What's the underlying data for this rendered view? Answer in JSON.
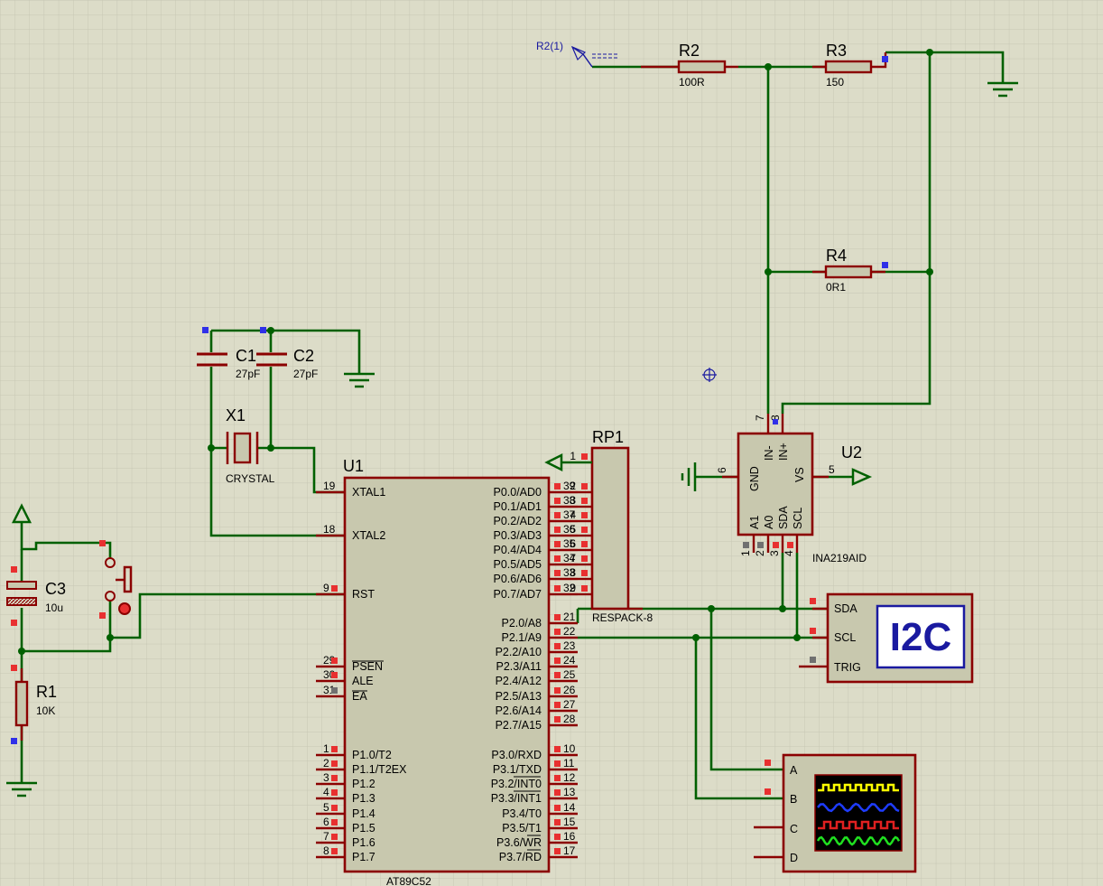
{
  "terminal": {
    "label": "R2(1)"
  },
  "resistors": {
    "r1": {
      "ref": "R1",
      "value": "10K"
    },
    "r2": {
      "ref": "R2",
      "value": "100R"
    },
    "r3": {
      "ref": "R3",
      "value": "150"
    },
    "r4": {
      "ref": "R4",
      "value": "0R1"
    }
  },
  "capacitors": {
    "c1": {
      "ref": "C1",
      "value": "27pF"
    },
    "c2": {
      "ref": "C2",
      "value": "27pF"
    },
    "c3": {
      "ref": "C3",
      "value": "10u"
    }
  },
  "crystal": {
    "ref": "X1",
    "value": "CRYSTAL"
  },
  "u1": {
    "ref": "U1",
    "part": "AT89C52",
    "left_pins": [
      {
        "num": "19",
        "name": "XTAL1"
      },
      {
        "num": "18",
        "name": "XTAL2"
      },
      {
        "num": "9",
        "name": "RST"
      },
      {
        "num": "29",
        "name": "PSEN"
      },
      {
        "num": "30",
        "name": "ALE"
      },
      {
        "num": "31",
        "name": "EA"
      },
      {
        "num": "1",
        "name": "P1.0/T2"
      },
      {
        "num": "2",
        "name": "P1.1/T2EX"
      },
      {
        "num": "3",
        "name": "P1.2"
      },
      {
        "num": "4",
        "name": "P1.3"
      },
      {
        "num": "5",
        "name": "P1.4"
      },
      {
        "num": "6",
        "name": "P1.5"
      },
      {
        "num": "7",
        "name": "P1.6"
      },
      {
        "num": "8",
        "name": "P1.7"
      }
    ],
    "right_pins": [
      {
        "num": "39",
        "name": "P0.0/AD0"
      },
      {
        "num": "38",
        "name": "P0.1/AD1"
      },
      {
        "num": "37",
        "name": "P0.2/AD2"
      },
      {
        "num": "36",
        "name": "P0.3/AD3"
      },
      {
        "num": "35",
        "name": "P0.4/AD4"
      },
      {
        "num": "34",
        "name": "P0.5/AD5"
      },
      {
        "num": "33",
        "name": "P0.6/AD6"
      },
      {
        "num": "32",
        "name": "P0.7/AD7"
      },
      {
        "num": "21",
        "name": "P2.0/A8"
      },
      {
        "num": "22",
        "name": "P2.1/A9"
      },
      {
        "num": "23",
        "name": "P2.2/A10"
      },
      {
        "num": "24",
        "name": "P2.3/A11"
      },
      {
        "num": "25",
        "name": "P2.4/A12"
      },
      {
        "num": "26",
        "name": "P2.5/A13"
      },
      {
        "num": "27",
        "name": "P2.6/A14"
      },
      {
        "num": "28",
        "name": "P2.7/A15"
      },
      {
        "num": "10",
        "name": "P3.0/RXD"
      },
      {
        "num": "11",
        "name": "P3.1/TXD"
      },
      {
        "num": "12",
        "name": "P3.2/INT0"
      },
      {
        "num": "13",
        "name": "P3.3/INT1"
      },
      {
        "num": "14",
        "name": "P3.4/T0"
      },
      {
        "num": "15",
        "name": "P3.5/T1"
      },
      {
        "num": "16",
        "name": "P3.6/WR"
      },
      {
        "num": "17",
        "name": "P3.7/RD"
      }
    ]
  },
  "rp1": {
    "ref": "RP1",
    "part": "RESPACK-8",
    "pins": [
      "1",
      "2",
      "3",
      "4",
      "5",
      "6",
      "7",
      "8",
      "9"
    ]
  },
  "u2": {
    "ref": "U2",
    "part": "INA219AID",
    "pins": [
      {
        "num": "7",
        "name": "IN-"
      },
      {
        "num": "8",
        "name": "IN+"
      },
      {
        "num": "6",
        "name": "GND"
      },
      {
        "num": "5",
        "name": "VS"
      },
      {
        "num": "1",
        "name": "A1"
      },
      {
        "num": "2",
        "name": "A0"
      },
      {
        "num": "3",
        "name": "SDA"
      },
      {
        "num": "4",
        "name": "SCL"
      }
    ]
  },
  "i2c_debugger": {
    "title": "I2C",
    "pins": [
      "SDA",
      "SCL",
      "TRIG"
    ]
  },
  "oscilloscope": {
    "channels": [
      "A",
      "B",
      "C",
      "D"
    ],
    "trace_colors": [
      "#ffff00",
      "#1e3cff",
      "#e02020",
      "#20e020"
    ]
  },
  "colors": {
    "wire": "#006000",
    "component_outline": "#8b0000",
    "component_fill": "#c8c8ae",
    "background": "#dcdcc8",
    "grid": "#c6c6b4",
    "label_blue": "#1a1aa0"
  }
}
